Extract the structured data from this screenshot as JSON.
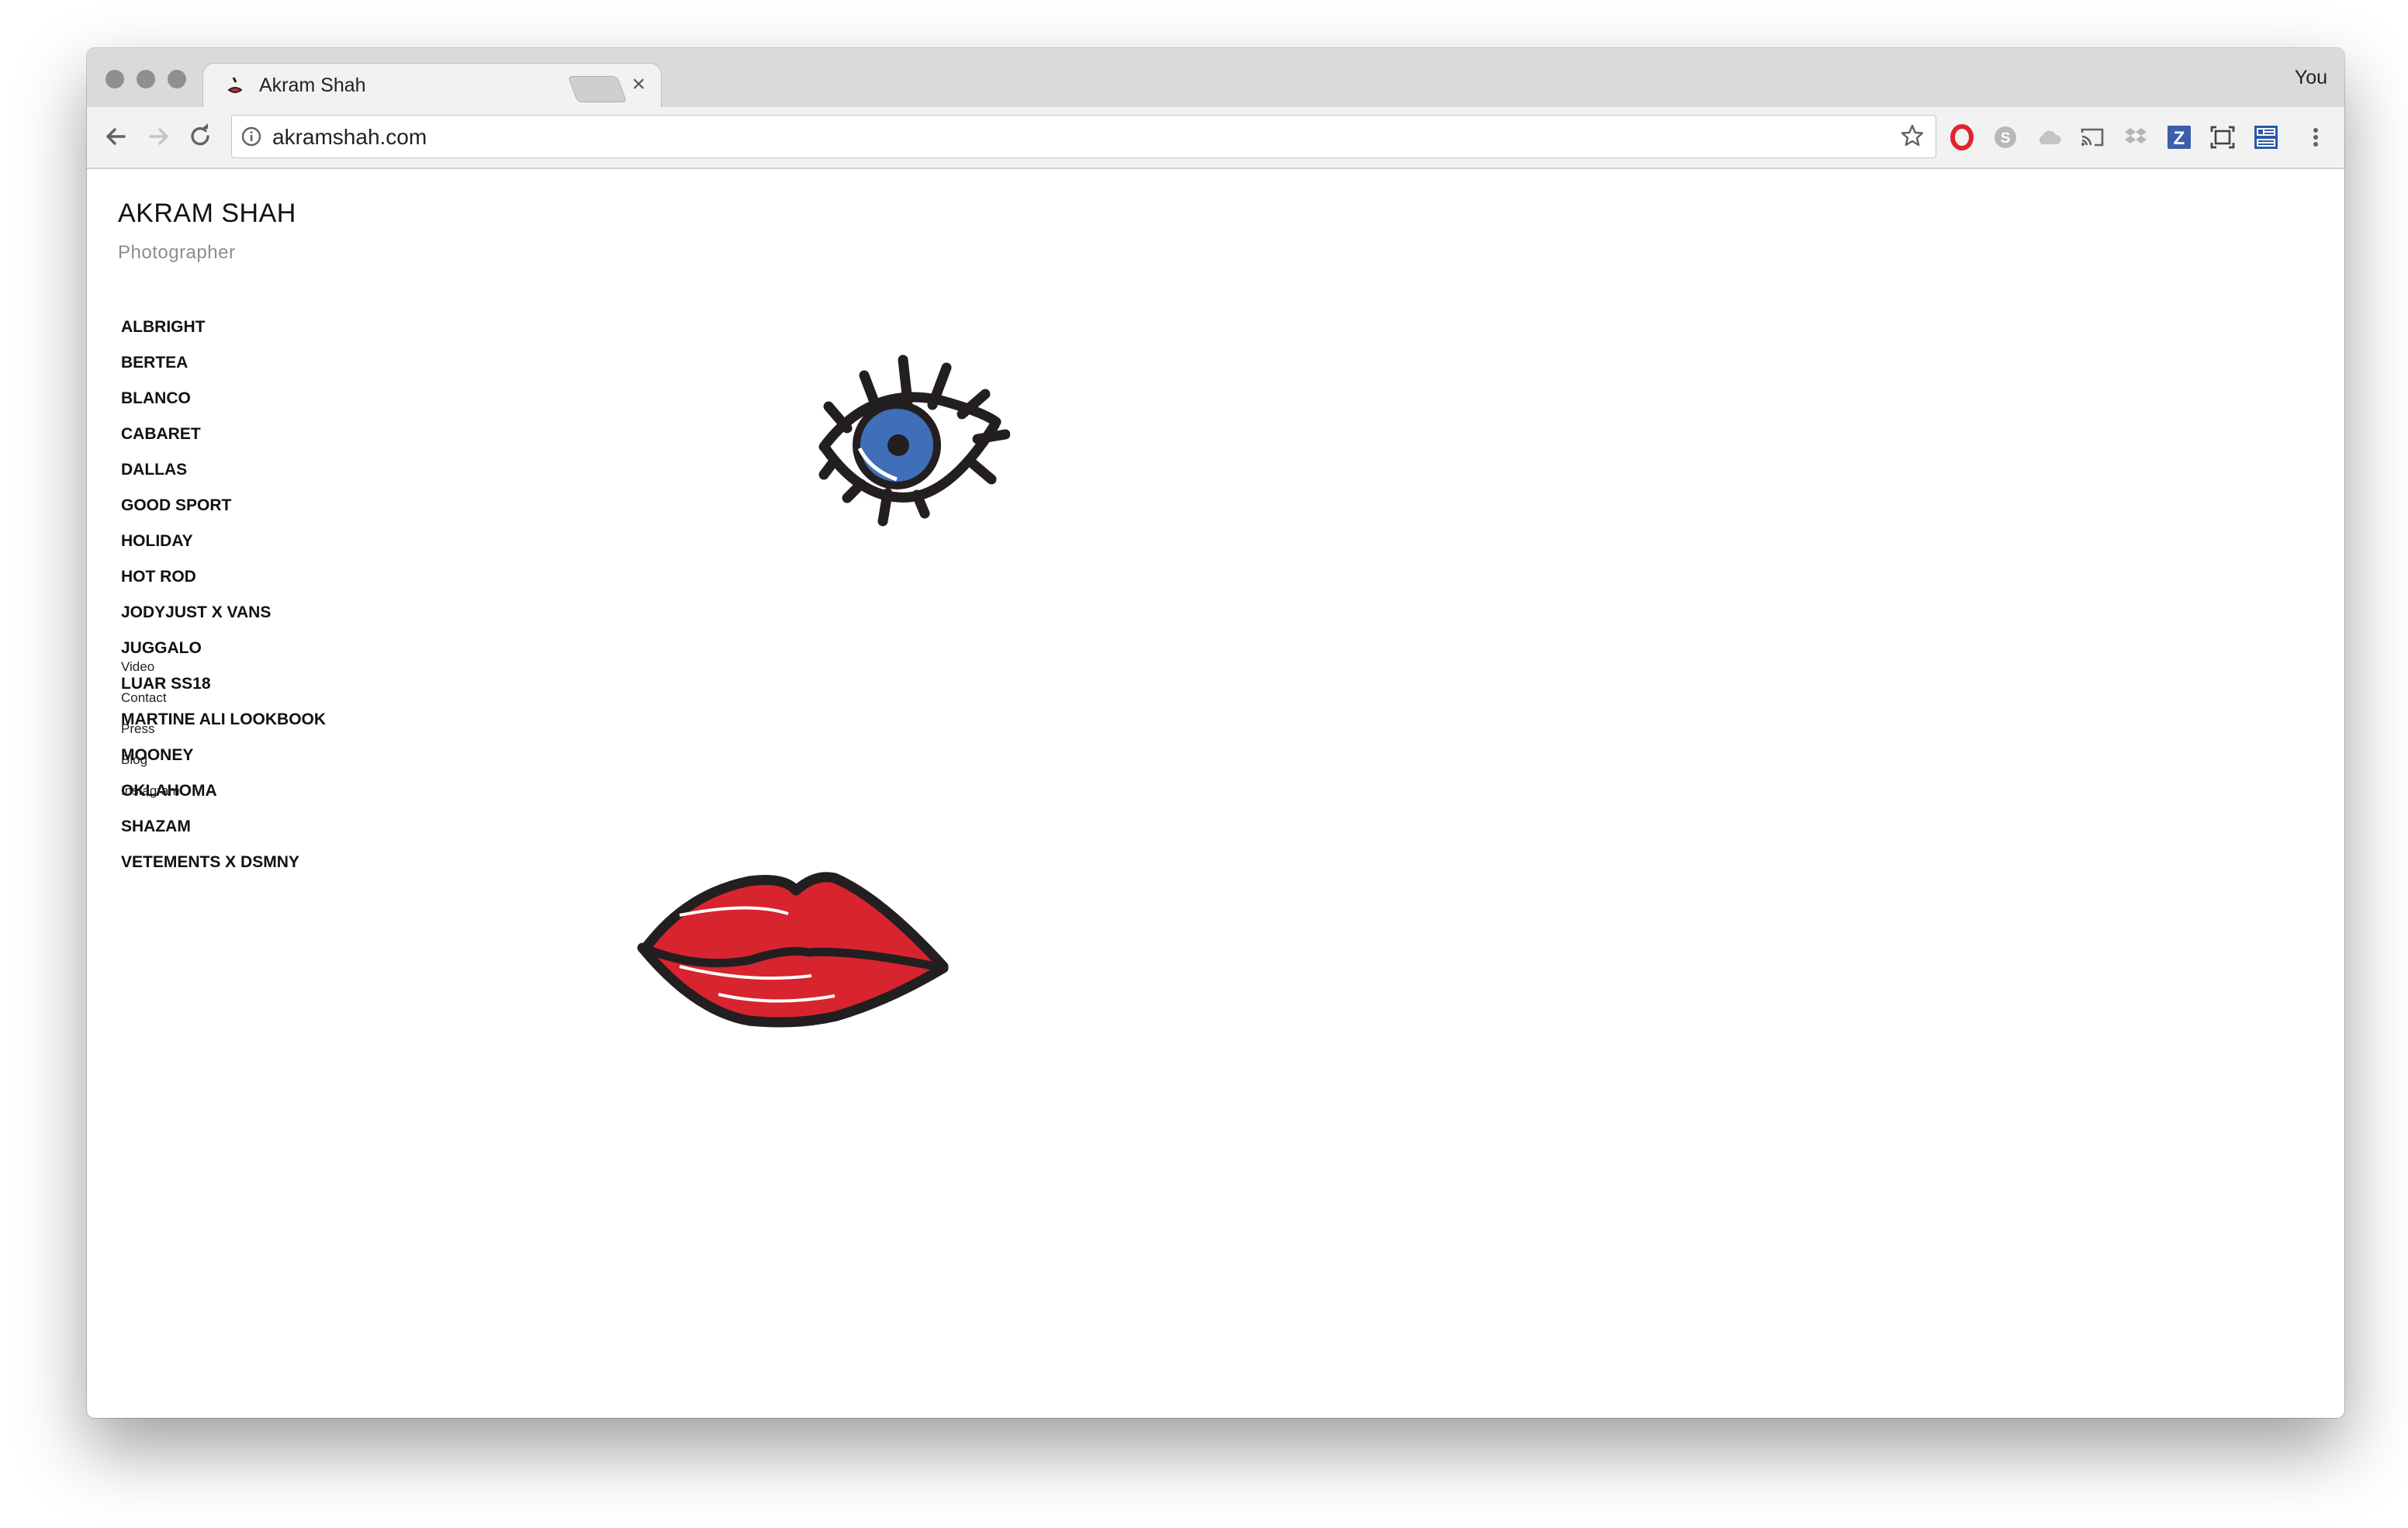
{
  "browser": {
    "tab_title": "Akram Shah",
    "tab_close": "×",
    "profile_name": "You",
    "url": "akramshah.com"
  },
  "site": {
    "title": "AKRAM SHAH",
    "subtitle": "Photographer",
    "projects": [
      "ALBRIGHT",
      "BERTEA",
      "BLANCO",
      "CABARET",
      "DALLAS",
      "GOOD SPORT",
      "HOLIDAY",
      "HOT ROD",
      "JODYJUST X VANS",
      "JUGGALO",
      "LUAR SS18",
      "MARTINE ALI LOOKBOOK",
      "MOONEY",
      "OKLAHOMA",
      "SHAZAM",
      "VETEMENTS X DSMNY"
    ],
    "links": [
      "Video",
      "Contact",
      "Press",
      "Blog",
      "Instagram"
    ]
  },
  "colors": {
    "eye_iris": "#3f6fb8",
    "lips_red": "#d8242f",
    "outline": "#231f20"
  },
  "icons": {
    "extensions": [
      "opera-icon",
      "skype-icon",
      "cloud-icon",
      "cast-icon",
      "dropbox-icon",
      "zotero-icon",
      "screenshot-icon",
      "news-icon",
      "menu-icon"
    ]
  }
}
